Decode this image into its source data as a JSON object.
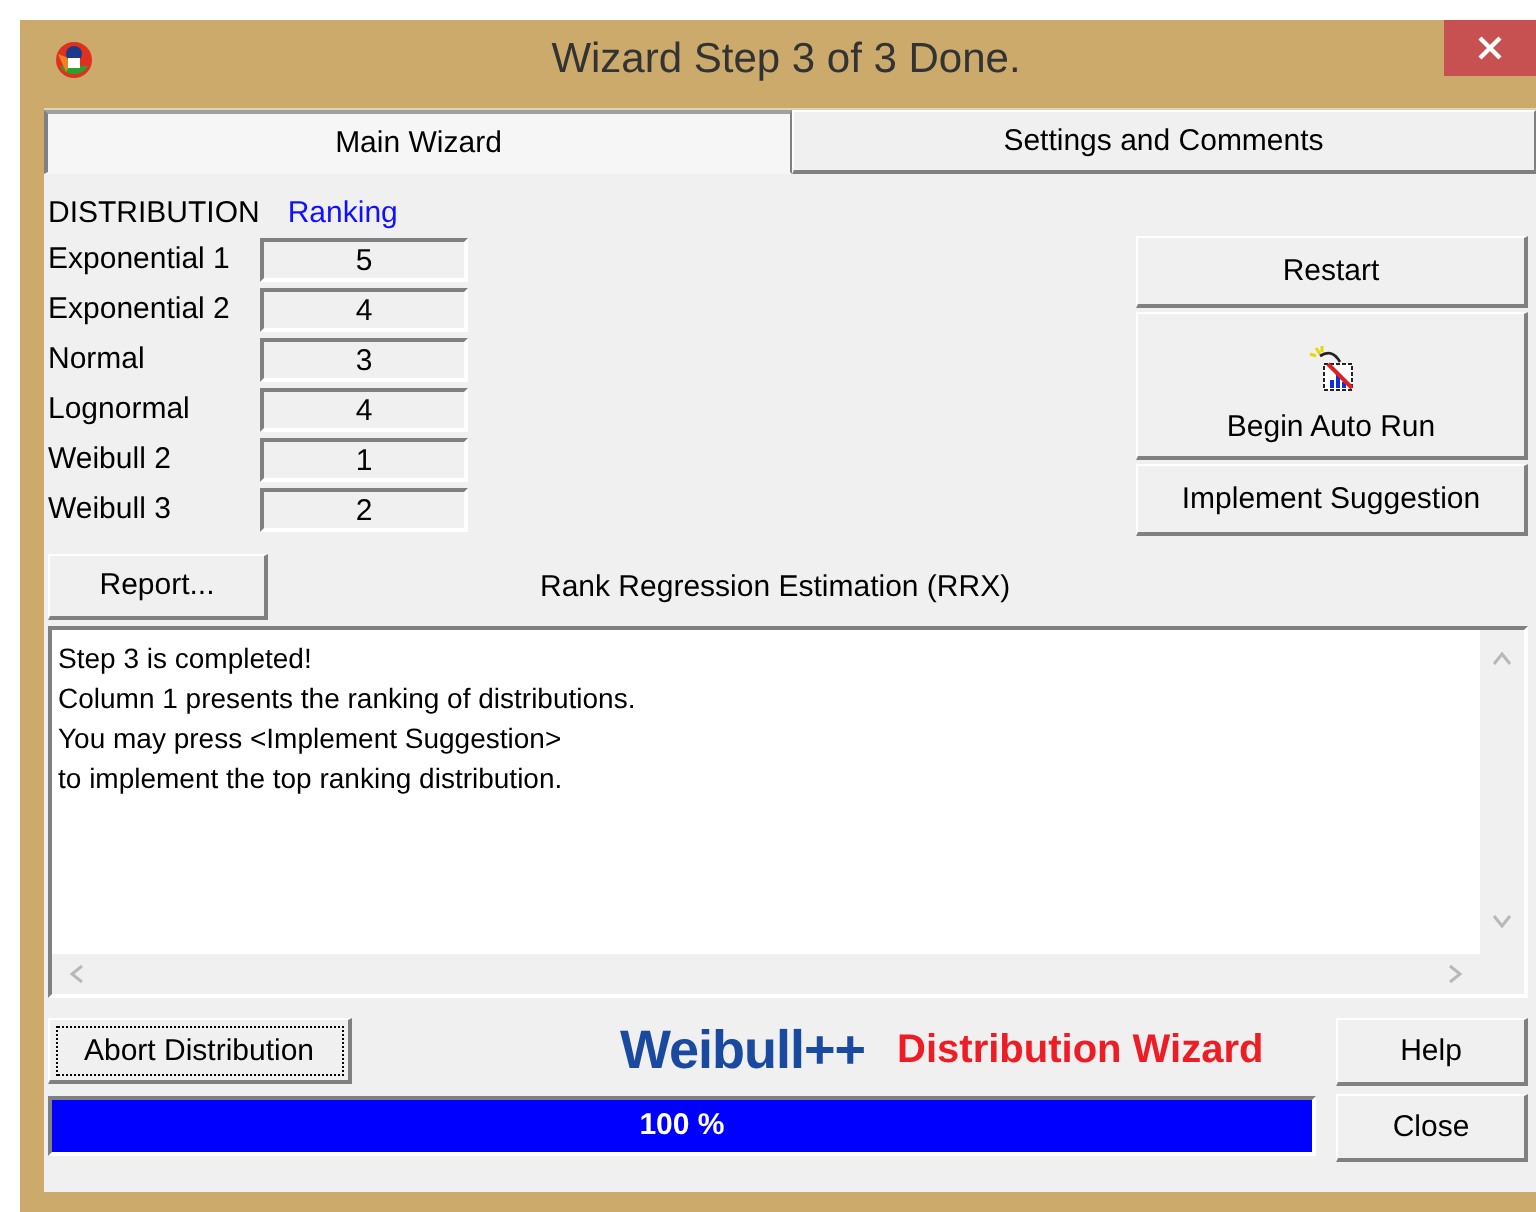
{
  "window": {
    "title": "Wizard Step 3 of 3 Done."
  },
  "tabs": [
    {
      "label": "Main Wizard",
      "selected": true
    },
    {
      "label": "Settings and Comments",
      "selected": false
    }
  ],
  "ranking": {
    "heading": "DISTRIBUTION",
    "column": "Ranking",
    "rows": [
      {
        "name": "Exponential 1",
        "rank": "5"
      },
      {
        "name": "Exponential 2",
        "rank": "4"
      },
      {
        "name": "Normal",
        "rank": "3"
      },
      {
        "name": "Lognormal",
        "rank": "4"
      },
      {
        "name": "Weibull 2",
        "rank": "1"
      },
      {
        "name": "Weibull 3",
        "rank": "2"
      }
    ]
  },
  "actions": [
    {
      "kind": "text",
      "label": "Restart"
    },
    {
      "kind": "icon",
      "label": "Begin Auto Run"
    },
    {
      "kind": "text",
      "label": "Implement Suggestion"
    }
  ],
  "report_button": "Report...",
  "method": "Rank Regression Estimation (RRX)",
  "message": [
    "Step 3 is completed!",
    "Column 1 presents the ranking of distributions.",
    "You may press <Implement Suggestion>",
    "to implement the top ranking distribution."
  ],
  "abort_button": "Abort Distribution",
  "brand": {
    "product": "Weibull++",
    "subtitle": "Distribution Wizard"
  },
  "progress": {
    "level": 1,
    "text": "100 %"
  },
  "help_button": "Help",
  "close_button": "Close"
}
